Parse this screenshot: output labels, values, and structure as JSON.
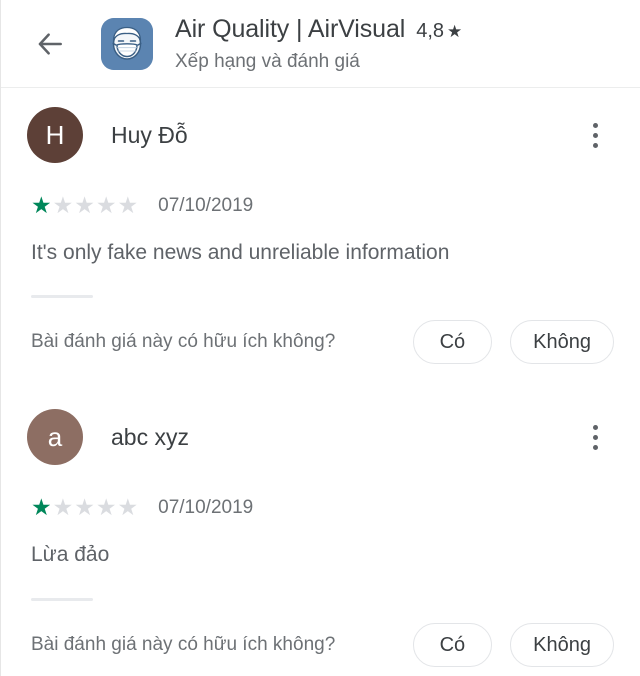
{
  "header": {
    "back_icon": "back-arrow-icon",
    "app_icon": "masked-face-app-icon",
    "app_title": "Air Quality | AirVisual",
    "rating": "4,8",
    "rating_star": "★",
    "subtitle": "Xếp hạng và đánh giá"
  },
  "colors": {
    "star_filled": "#00875a",
    "star_empty": "#dadce0",
    "app_icon_bg": "#5b84b1",
    "avatar_1": "#5d4037",
    "avatar_2": "#8d6e63"
  },
  "reviews": [
    {
      "avatar_letter": "H",
      "avatar_color": "#5d4037",
      "name": "Huy Đỗ",
      "rating": 1,
      "max_rating": 5,
      "date": "07/10/2019",
      "text": "It's only fake news and unreliable information",
      "helpful_question": "Bài đánh giá này có hữu ích không?",
      "yes_label": "Có",
      "no_label": "Không",
      "overflow_icon": "more-vert-icon"
    },
    {
      "avatar_letter": "a",
      "avatar_color": "#8d6e63",
      "name": "abc xyz",
      "rating": 1,
      "max_rating": 5,
      "date": "07/10/2019",
      "text": "Lừa đảo",
      "helpful_question": "Bài đánh giá này có hữu ích không?",
      "yes_label": "Có",
      "no_label": "Không",
      "overflow_icon": "more-vert-icon"
    }
  ],
  "star_glyph": "★"
}
